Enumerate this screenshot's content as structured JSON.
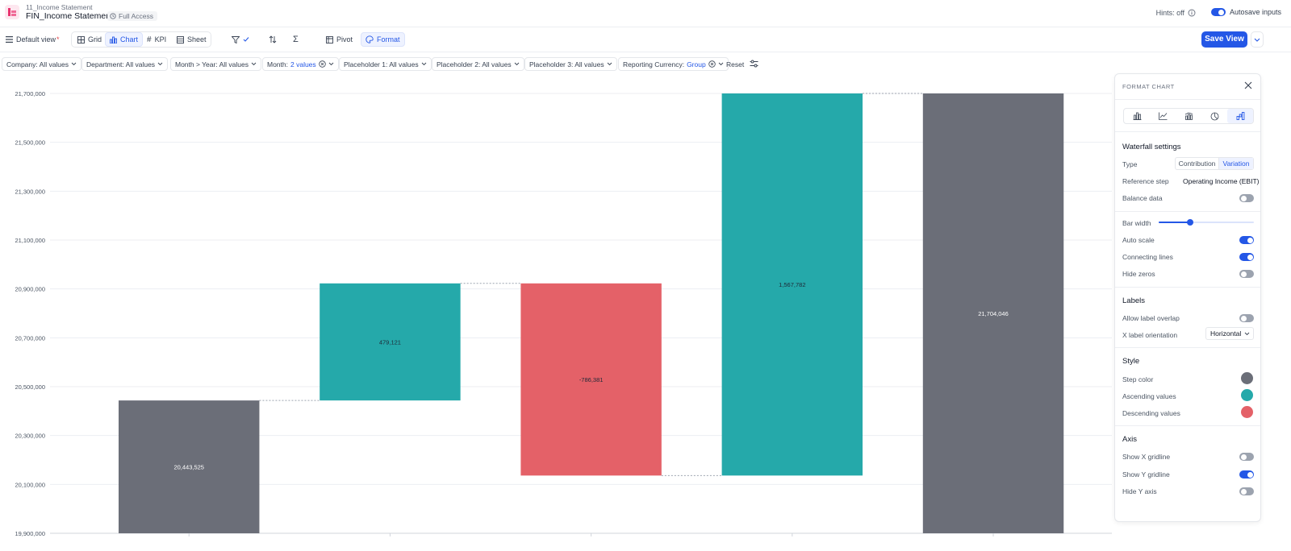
{
  "header": {
    "breadcrumb": "11_Income Statement",
    "title": "FIN_Income Statement",
    "access": "Full Access",
    "hints": "Hints: off",
    "autosave": "Autosave inputs"
  },
  "toolbar": {
    "view_name": "Default view",
    "modified_mark": "*",
    "views": [
      "Grid",
      "Chart",
      "KPI",
      "Sheet"
    ],
    "active_view": "Chart",
    "pivot": "Pivot",
    "format": "Format",
    "save": "Save View"
  },
  "filters": {
    "company": "Company: All values",
    "department": "Department: All values",
    "month_year": "Month > Year: All values",
    "month_label": "Month:",
    "month_value": "2 values",
    "placeholder1": "Placeholder 1: All values",
    "placeholder2": "Placeholder 2: All values",
    "placeholder3": "Placeholder 3: All values",
    "currency_label": "Reporting Currency:",
    "currency_value": "Group",
    "reset": "Reset"
  },
  "chart_data": {
    "type": "waterfall",
    "ylim": [
      19900000,
      21700000
    ],
    "yticks": [
      19900000,
      20100000,
      20300000,
      20500000,
      20700000,
      20900000,
      21100000,
      21300000,
      21500000,
      21700000
    ],
    "tick_labels": [
      "19,900,000",
      "20,100,000",
      "20,300,000",
      "20,500,000",
      "20,700,000",
      "20,900,000",
      "21,100,000",
      "21,300,000",
      "21,500,000",
      "21,700,000"
    ],
    "steps": [
      {
        "kind": "total",
        "value": 20443525,
        "label": "20,443,525"
      },
      {
        "kind": "increase",
        "value": 479121,
        "label": "479,121"
      },
      {
        "kind": "decrease",
        "value": -786381,
        "label": "-786,381"
      },
      {
        "kind": "increase",
        "value": 1567782,
        "label": "1,567,782"
      },
      {
        "kind": "total",
        "value": 21704046,
        "label": "21,704,046"
      }
    ],
    "colors": {
      "step": "#6b6e78",
      "ascending": "#25a9aa",
      "descending": "#e46168"
    },
    "grid_y": true,
    "grid_x": false,
    "connecting_lines": true
  },
  "panel": {
    "title": "FORMAT CHART",
    "waterfall_heading": "Waterfall settings",
    "type_label": "Type",
    "type_options": [
      "Contribution",
      "Variation"
    ],
    "type_selected": "Variation",
    "reference_label": "Reference step",
    "reference_value": "Operating Income (EBIT)",
    "balance_label": "Balance data",
    "balance": false,
    "bar_width_label": "Bar width",
    "bar_width": 0.33,
    "auto_scale_label": "Auto scale",
    "auto_scale": true,
    "connecting_label": "Connecting lines",
    "connecting": true,
    "hide_zeros_label": "Hide zeros",
    "hide_zeros": false,
    "labels_heading": "Labels",
    "overlap_label": "Allow label overlap",
    "overlap": false,
    "orientation_label": "X label orientation",
    "orientation_value": "Horizontal",
    "style_heading": "Style",
    "step_color_label": "Step color",
    "asc_label": "Ascending values",
    "desc_label": "Descending values",
    "axis_heading": "Axis",
    "show_x_label": "Show X gridline",
    "show_x": false,
    "show_y_label": "Show Y gridline",
    "show_y": true,
    "hide_y_label": "Hide Y axis",
    "hide_y": false
  }
}
